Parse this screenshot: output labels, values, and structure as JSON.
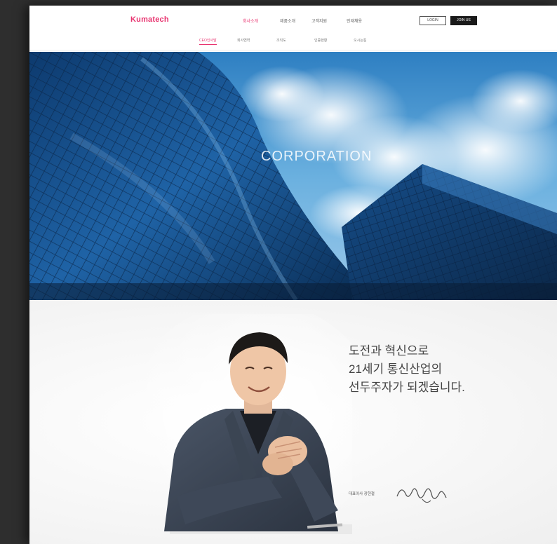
{
  "header": {
    "logo": "Kumatech",
    "gnb": [
      "회사소개",
      "제품소개",
      "고객지원",
      "인재채용"
    ],
    "login_label": "LOGIN",
    "join_label": "JOIN US"
  },
  "subnav": [
    "CEO인사말",
    "회사연혁",
    "조직도",
    "인증현황",
    "오시는길"
  ],
  "hero": {
    "title": "CORPORATION",
    "subtitle_1": "",
    "subtitle_2": ""
  },
  "ceo_section": {
    "greeting_line_1": "도전과 혁신으로",
    "greeting_line_2": "21세기 통신산업의",
    "greeting_line_3": "선두주자가 되겠습니다.",
    "paragraph_1": [
      "",
      "",
      ""
    ],
    "paragraph_2": [
      "",
      "",
      "",
      "",
      ""
    ],
    "signature_label": "대표이사 장현철",
    "signature_alt": ""
  },
  "colors": {
    "accent": "#e8336f",
    "sky": "#5aa2d6",
    "frame_bg": "#2e2e2e"
  }
}
